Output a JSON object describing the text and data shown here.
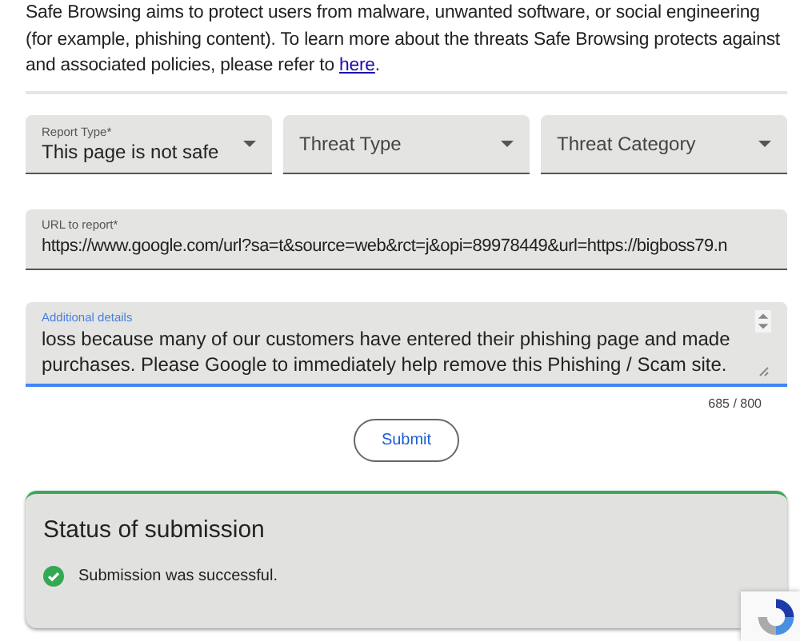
{
  "intro": {
    "text": "Safe Browsing aims to protect users from malware, unwanted software, or social engineering (for example, phishing content). To learn more about the threats Safe Browsing protects against and associated policies, please refer to ",
    "link": "here",
    "after": "."
  },
  "dropdowns": [
    {
      "label": "Report Type*",
      "value": "This page is not safe"
    },
    {
      "placeholder": "Threat Type"
    },
    {
      "placeholder": "Threat Category"
    }
  ],
  "url_field": {
    "label": "URL to report*",
    "value": "https://www.google.com/url?sa=t&source=web&rct=j&opi=89978449&url=https://bigboss79.n"
  },
  "details_field": {
    "label": "Additional details",
    "value": "loss because many of our customers have entered their phishing page and made purchases. Please Google to immediately help remove this Phishing / Scam site.",
    "focused": true,
    "counter": "685 / 800"
  },
  "submit_button": "Submit",
  "status": {
    "title": "Status of submission",
    "message": "Submission was successful.",
    "kind": "success"
  }
}
